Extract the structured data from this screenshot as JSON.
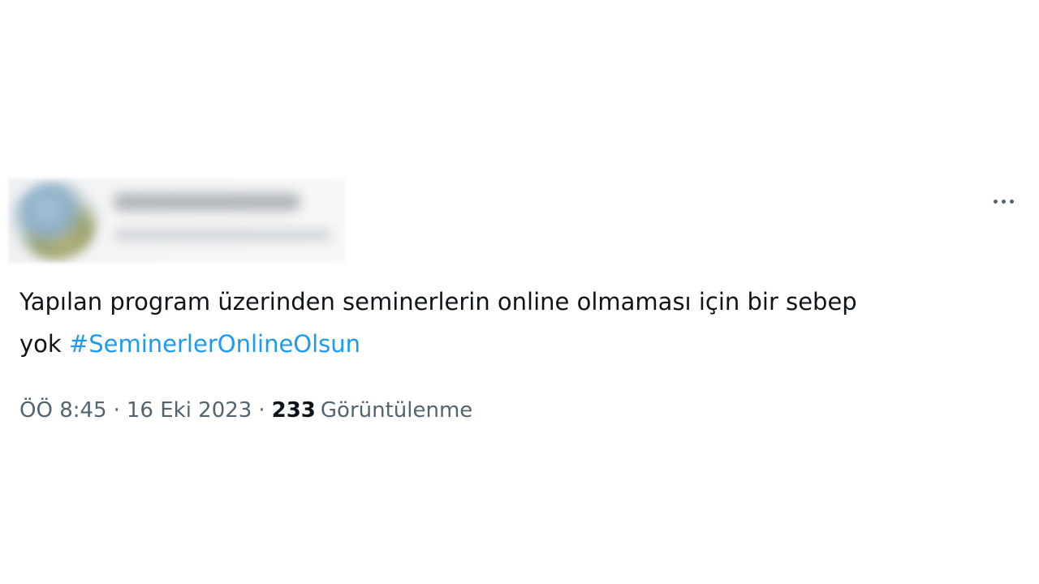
{
  "tweet": {
    "text_line1": "Yapılan program üzerinden seminerlerin online olmaması için bir sebep",
    "text_line2_prefix": "yok ",
    "hashtag": "#SeminerlerOnlineOlsun",
    "time": "ÖÖ 8:45",
    "date": "16 Eki 2023",
    "separator": "·",
    "views_count": "233",
    "views_label": "Görüntülenme"
  },
  "icons": {
    "more": "more-horizontal-icon"
  },
  "colors": {
    "text": "#0f1419",
    "secondary": "#536471",
    "link": "#1d9bf0",
    "background": "#ffffff"
  }
}
